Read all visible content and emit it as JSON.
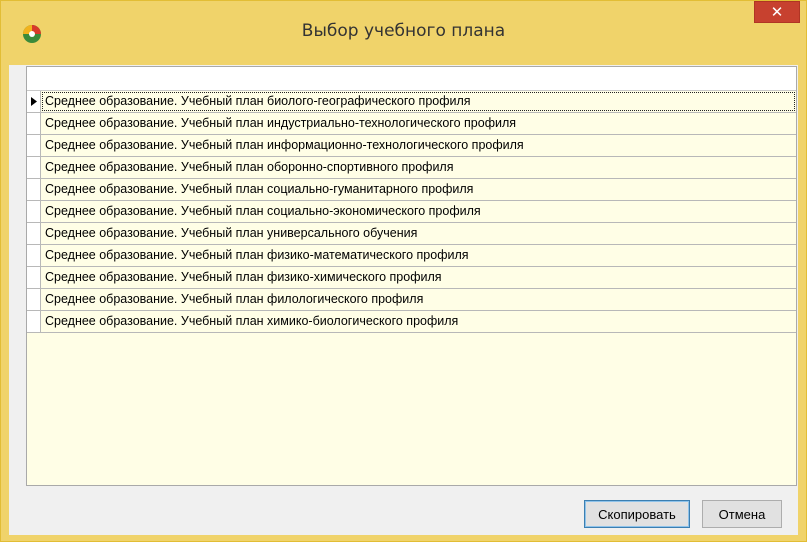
{
  "window": {
    "title": "Выбор учебного плана",
    "close_glyph": "✕",
    "frame_color": "#f0d36a",
    "close_color": "#c7412f"
  },
  "grid": {
    "selected_index": 0,
    "rows": [
      "Среднее образование. Учебный план биолого-географического профиля",
      "Среднее образование. Учебный план индустриально-технологического профиля",
      "Среднее образование. Учебный план информационно-технологического профиля",
      "Среднее образование. Учебный план оборонно-спортивного профиля",
      "Среднее образование. Учебный план социально-гуманитарного профиля",
      "Среднее образование. Учебный план социально-экономического профиля",
      "Среднее образование. Учебный план универсального обучения",
      "Среднее образование. Учебный план физико-математического профиля",
      "Среднее образование. Учебный план физико-химического профиля",
      "Среднее образование. Учебный план филологического профиля",
      "Среднее образование. Учебный план химико-биологического профиля"
    ]
  },
  "buttons": {
    "copy_label": "Скопировать",
    "cancel_label": "Отмена"
  }
}
